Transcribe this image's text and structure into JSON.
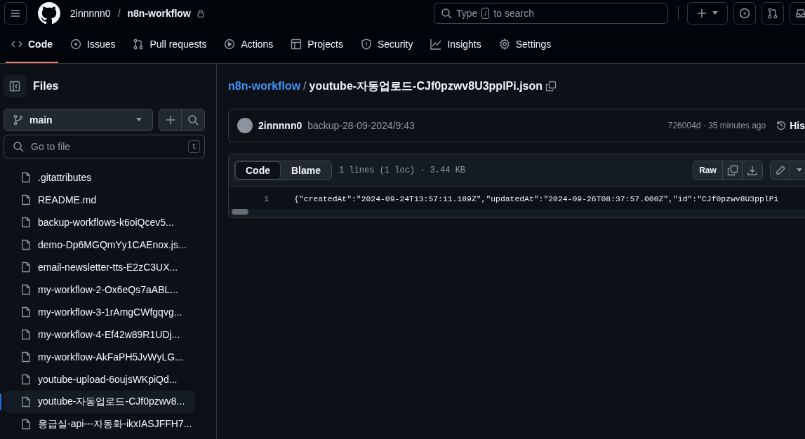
{
  "header": {
    "owner": "2innnnn0",
    "separator": "/",
    "repo": "n8n-workflow",
    "search_placeholder_before": "Type",
    "search_key": "/",
    "search_placeholder_after": "to search"
  },
  "tabs": [
    {
      "label": "Code",
      "kind": "code",
      "selected": true
    },
    {
      "label": "Issues",
      "kind": "issue",
      "selected": false
    },
    {
      "label": "Pull requests",
      "kind": "pr",
      "selected": false
    },
    {
      "label": "Actions",
      "kind": "play",
      "selected": false
    },
    {
      "label": "Projects",
      "kind": "table",
      "selected": false
    },
    {
      "label": "Security",
      "kind": "shield",
      "selected": false
    },
    {
      "label": "Insights",
      "kind": "graph",
      "selected": false
    },
    {
      "label": "Settings",
      "kind": "gear",
      "selected": false
    }
  ],
  "sidebar": {
    "title": "Files",
    "branch": "main",
    "filter_placeholder": "Go to file",
    "filter_key": "t",
    "items": [
      {
        "name": ".gitattributes",
        "selected": false
      },
      {
        "name": "README.md",
        "selected": false
      },
      {
        "name": "backup-workflows-k6oiQcev5...",
        "selected": false
      },
      {
        "name": "demo-Dp6MGQmYy1CAEnox.js...",
        "selected": false
      },
      {
        "name": "email-newsletter-tts-E2zC3UX...",
        "selected": false
      },
      {
        "name": "my-workflow-2-Ox6eQs7aABL...",
        "selected": false
      },
      {
        "name": "my-workflow-3-1rAmgCWfgqvg...",
        "selected": false
      },
      {
        "name": "my-workflow-4-Ef42w89R1UDj...",
        "selected": false
      },
      {
        "name": "my-workflow-AkFaPH5JvWyLG...",
        "selected": false
      },
      {
        "name": "youtube-upload-6oujsWKpiQd...",
        "selected": false
      },
      {
        "name": "youtube-자동업로드-CJf0pzwv8...",
        "selected": true
      },
      {
        "name": "응급실-api---자동화-ikxIASJFFH7...",
        "selected": false
      }
    ]
  },
  "breadcrumb": {
    "repo": "n8n-workflow",
    "separator": "/",
    "file": "youtube-자동업로드-CJf0pzwv8U3pplPi.json"
  },
  "commit": {
    "author": "2innnnn0",
    "message": "backup-28-09-2024/9:43",
    "meta": "726004d · 35 minutes ago",
    "history": "His"
  },
  "file_view": {
    "modes": [
      {
        "label": "Code",
        "selected": true
      },
      {
        "label": "Blame",
        "selected": false
      }
    ],
    "info": "1 lines (1 loc) · 3.44 KB",
    "raw": "Raw",
    "lines": [
      {
        "number": "1",
        "text": "{\"createdAt\":\"2024-09-24T13:57:11.189Z\",\"updatedAt\":\"2024-09-26T08:37:57.000Z\",\"id\":\"CJf0pzwv8U3pplPi"
      }
    ]
  }
}
